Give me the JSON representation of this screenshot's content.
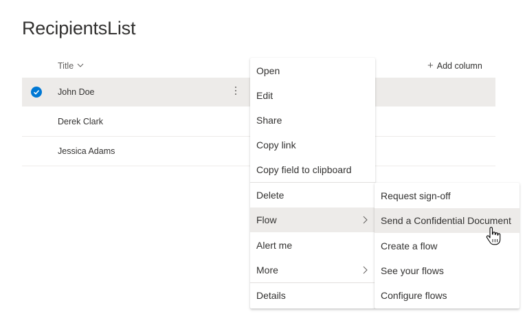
{
  "list": {
    "title": "RecipientsList",
    "column_title": "Title",
    "add_column_label": "Add column",
    "rows": [
      {
        "title": "John Doe",
        "selected": true
      },
      {
        "title": "Derek Clark",
        "selected": false
      },
      {
        "title": "Jessica Adams",
        "selected": false
      }
    ]
  },
  "context_menu": {
    "items": [
      {
        "label": "Open"
      },
      {
        "label": "Edit"
      },
      {
        "label": "Share"
      },
      {
        "label": "Copy link"
      },
      {
        "label": "Copy field to clipboard"
      },
      {
        "label": "Delete"
      },
      {
        "label": "Flow",
        "has_submenu": true,
        "highlighted": true
      },
      {
        "label": "Alert me"
      },
      {
        "label": "More",
        "has_submenu": true
      },
      {
        "label": "Details"
      }
    ]
  },
  "flow_submenu": {
    "items": [
      {
        "label": "Request sign-off"
      },
      {
        "label": "Send a Confidential Document",
        "highlighted": true
      },
      {
        "label": "Create a flow"
      },
      {
        "label": "See your flows"
      },
      {
        "label": "Configure flows"
      }
    ]
  },
  "colors": {
    "accent": "#0078d4",
    "selected_row": "#edebe9",
    "text": "#323130",
    "secondary_text": "#605e5c"
  },
  "icons": {
    "selected_check": "checkmark-circle-icon",
    "sort": "chevron-down-icon",
    "add": "plus-icon",
    "more": "more-vertical-icon",
    "submenu": "chevron-right-icon",
    "pointer": "hand-pointer-icon"
  }
}
